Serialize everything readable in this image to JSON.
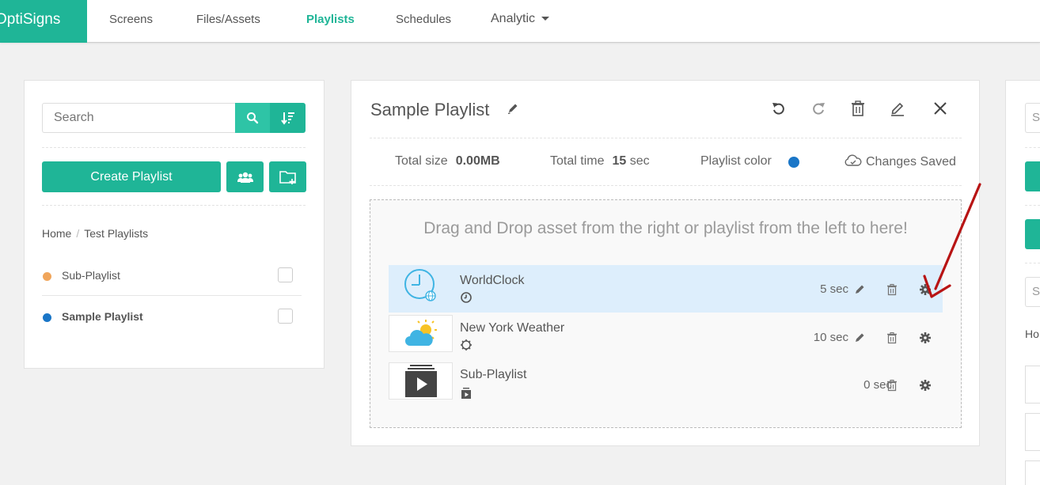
{
  "nav": {
    "brand": "OptiSigns",
    "items": [
      "Screens",
      "Files/Assets",
      "Playlists",
      "Schedules",
      "Analytic"
    ],
    "active": "Playlists"
  },
  "left": {
    "search_placeholder": "Search",
    "create_label": "Create Playlist",
    "breadcrumb": [
      "Home",
      "Test Playlists"
    ],
    "playlists": [
      {
        "name": "Sub-Playlist",
        "color": "#f0a55b",
        "bold": false
      },
      {
        "name": "Sample Playlist",
        "color": "#1a76c7",
        "bold": true
      }
    ]
  },
  "editor": {
    "title": "Sample Playlist",
    "total_size_label": "Total size",
    "total_size": "0.00MB",
    "total_time_label": "Total time",
    "total_time": "15",
    "total_time_unit": "sec",
    "color_label": "Playlist color",
    "playlist_color": "#1a76c7",
    "saved_status": "Changes Saved",
    "drop_hint": "Drag and Drop asset from the right or playlist from the left to here!",
    "assets": [
      {
        "name": "WorldClock",
        "duration": "5 sec",
        "thumb": "world-clock-icon",
        "sub_icon": "clock-icon",
        "selected": true
      },
      {
        "name": "New York Weather",
        "duration": "10 sec",
        "thumb": "weather-icon",
        "sub_icon": "gear-outline-icon",
        "selected": false
      },
      {
        "name": "Sub-Playlist",
        "duration": "0 sec",
        "thumb": "playlist-icon",
        "sub_icon": "playlist-small-icon",
        "selected": false
      }
    ]
  },
  "right": {
    "partial_search": "S",
    "partial_text": "Ho"
  },
  "colors": {
    "brand_green": "#1fb597",
    "selected_row": "#ddeefc",
    "annotation_arrow": "#b81414"
  }
}
